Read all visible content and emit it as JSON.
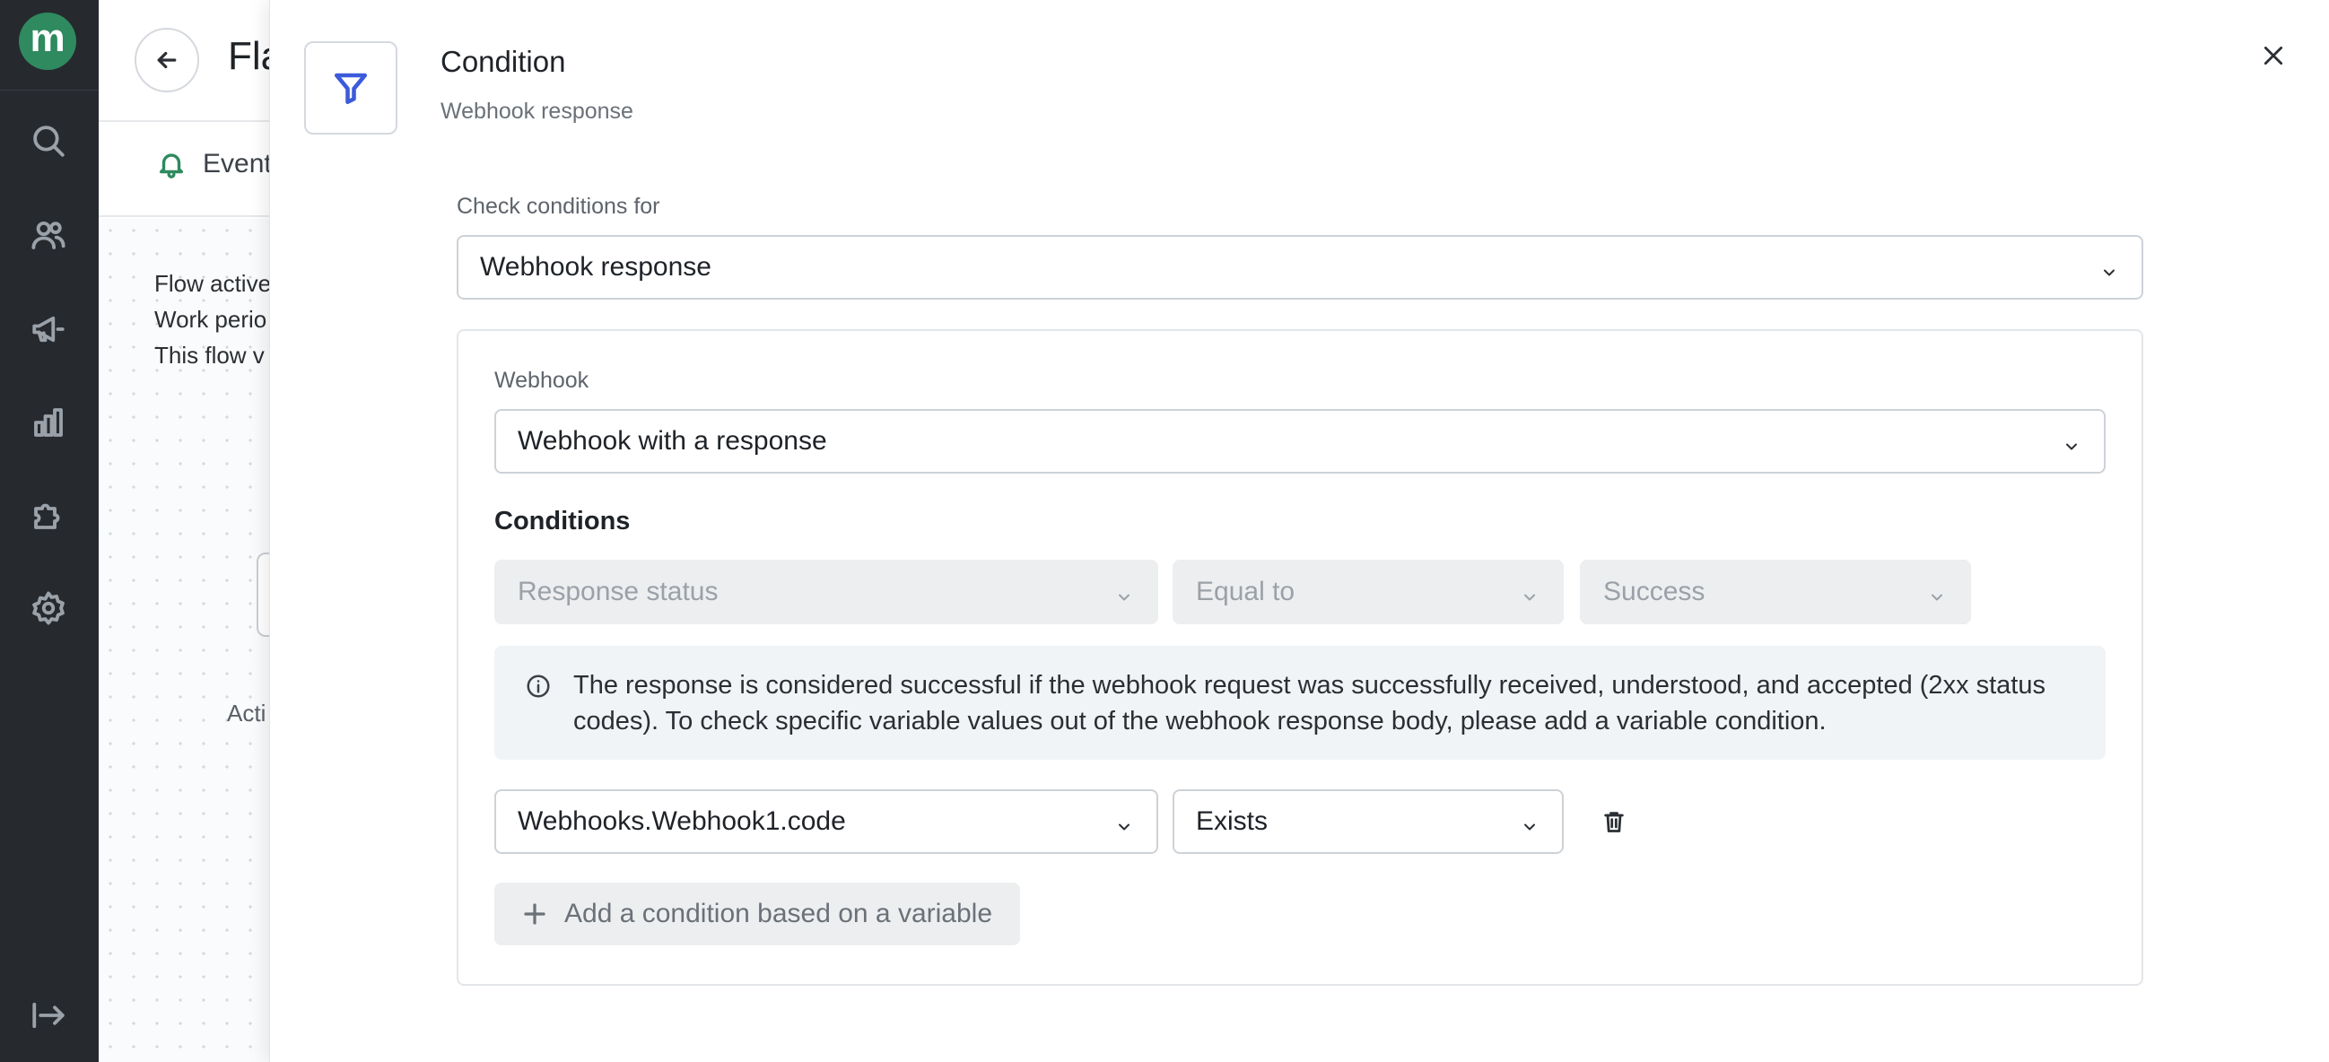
{
  "nav": {
    "logo_letter": "m",
    "icons": [
      "search-icon",
      "users-icon",
      "megaphone-icon",
      "bar-chart-icon",
      "puzzle-icon",
      "gear-icon",
      "collapse-sidebar-icon"
    ]
  },
  "background_page": {
    "title_partial": "Fla",
    "tab_partial": "Event",
    "info_lines": [
      "Flow active",
      "Work perio",
      "This flow v"
    ],
    "node_label_partial": "Acti"
  },
  "drawer": {
    "title": "Condition",
    "subtitle": "Webhook response",
    "check_conditions_label": "Check conditions for",
    "check_conditions_value": "Webhook response",
    "webhook_label": "Webhook",
    "webhook_value": "Webhook with a response",
    "conditions_heading": "Conditions",
    "response_condition": {
      "field": "Response status",
      "operator": "Equal to",
      "value": "Success"
    },
    "info_text": "The response is considered successful if the webhook request was successfully received, understood, and accepted (2xx status codes). To check specific variable values out of the webhook response body, please add a variable condition.",
    "variable_condition": {
      "variable": "Webhooks.Webhook1.code",
      "operator": "Exists"
    },
    "add_condition_label": "Add a condition based on a variable"
  },
  "colors": {
    "nav_bg": "#26292e",
    "brand_green": "#2f8a5f",
    "filter_icon_blue": "#3b5bdb",
    "disabled_bg": "#eceef0"
  }
}
